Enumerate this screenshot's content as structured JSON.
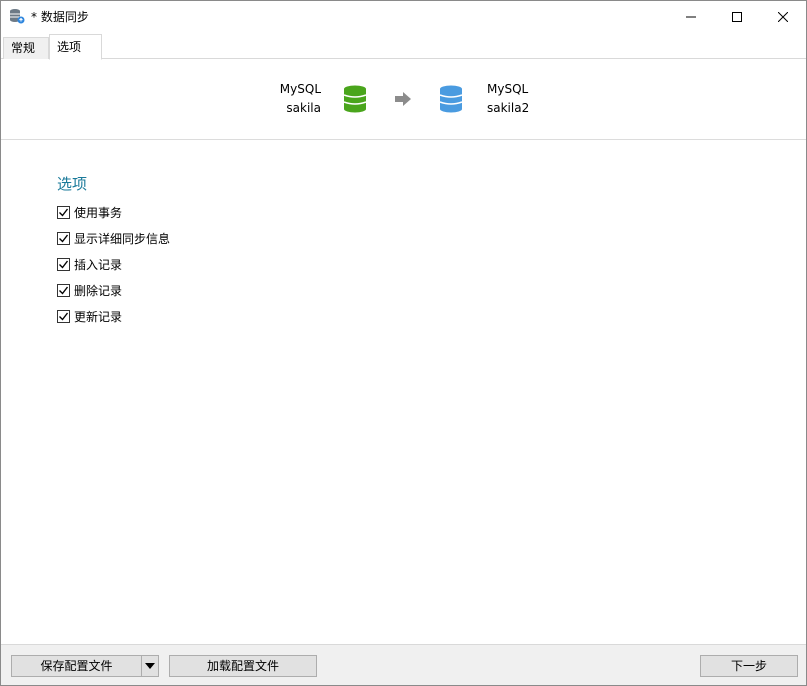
{
  "window": {
    "title": "* 数据同步",
    "app_icon": "database-sync-icon"
  },
  "tabs": [
    {
      "label": "常规",
      "active": false
    },
    {
      "label": "选项",
      "active": true
    }
  ],
  "connection": {
    "source": {
      "type": "MySQL",
      "database": "sakila",
      "color": "#4aa51c"
    },
    "target": {
      "type": "MySQL",
      "database": "sakila2",
      "color": "#4a9be0"
    },
    "arrow_color": "#8c8c8c"
  },
  "options": {
    "section_title": "选项",
    "title_color": "#1a7a9a",
    "items": [
      {
        "label": "使用事务",
        "checked": true
      },
      {
        "label": "显示详细同步信息",
        "checked": true
      },
      {
        "label": "插入记录",
        "checked": true
      },
      {
        "label": "删除记录",
        "checked": true
      },
      {
        "label": "更新记录",
        "checked": true
      }
    ]
  },
  "footer": {
    "save_label": "保存配置文件",
    "load_label": "加载配置文件",
    "next_label": "下一步"
  }
}
